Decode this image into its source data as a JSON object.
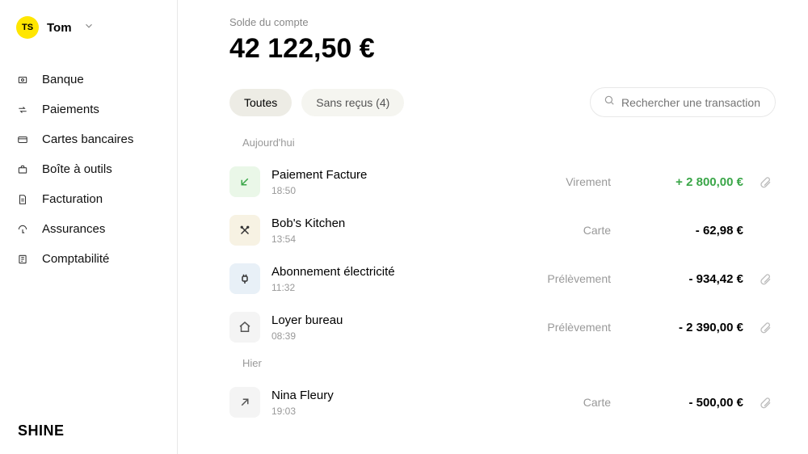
{
  "account": {
    "initials": "TS",
    "name": "Tom"
  },
  "brand": "SHINE",
  "nav": [
    {
      "id": "bank",
      "label": "Banque"
    },
    {
      "id": "payments",
      "label": "Paiements"
    },
    {
      "id": "cards",
      "label": "Cartes bancaires"
    },
    {
      "id": "toolbox",
      "label": "Boîte à outils"
    },
    {
      "id": "invoicing",
      "label": "Facturation"
    },
    {
      "id": "insurance",
      "label": "Assurances"
    },
    {
      "id": "accounting",
      "label": "Comptabilité"
    }
  ],
  "balance": {
    "label": "Solde du compte",
    "amount": "42 122,50 €"
  },
  "filters": {
    "all": "Toutes",
    "noreceipt": "Sans reçus (4)"
  },
  "search": {
    "placeholder": "Rechercher une transaction"
  },
  "groups": [
    {
      "label": "Aujourd'hui",
      "transactions": [
        {
          "title": "Paiement Facture",
          "time": "18:50",
          "type": "Virement",
          "amount": "+ 2 800,00 €",
          "positive": true,
          "icon": "arrow-in",
          "iconClass": "ic-green",
          "attachment": true
        },
        {
          "title": "Bob's Kitchen",
          "time": "13:54",
          "type": "Carte",
          "amount": "- 62,98 €",
          "positive": false,
          "icon": "food",
          "iconClass": "ic-cream",
          "attachment": false
        },
        {
          "title": "Abonnement électricité",
          "time": "11:32",
          "type": "Prélèvement",
          "amount": "- 934,42 €",
          "positive": false,
          "icon": "plug",
          "iconClass": "ic-blue",
          "attachment": true
        },
        {
          "title": "Loyer bureau",
          "time": "08:39",
          "type": "Prélèvement",
          "amount": "- 2 390,00 €",
          "positive": false,
          "icon": "house",
          "iconClass": "ic-gray",
          "attachment": true
        }
      ]
    },
    {
      "label": "Hier",
      "transactions": [
        {
          "title": "Nina Fleury",
          "time": "19:03",
          "type": "Carte",
          "amount": "- 500,00 €",
          "positive": false,
          "icon": "arrow-out",
          "iconClass": "ic-gray",
          "attachment": true
        }
      ]
    }
  ]
}
